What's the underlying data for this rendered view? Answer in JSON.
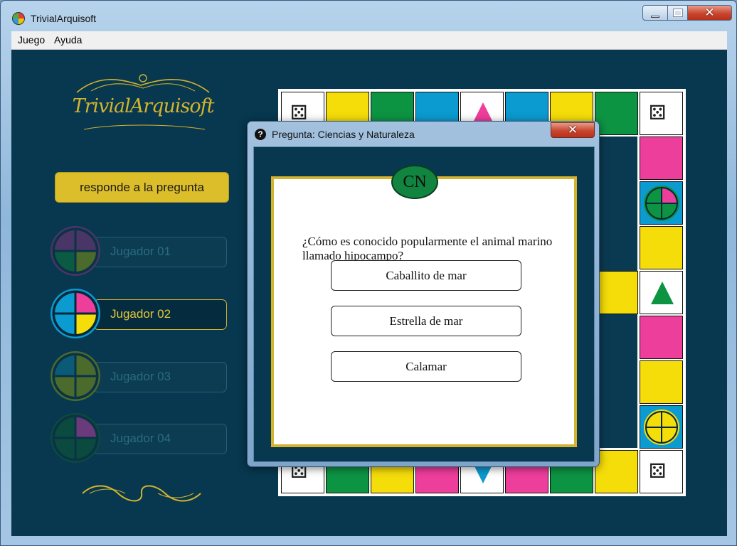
{
  "window": {
    "title": "TrivialArquisoft"
  },
  "menu": {
    "items": [
      {
        "label": "Juego"
      },
      {
        "label": "Ayuda"
      }
    ]
  },
  "left_panel": {
    "logo_text": "TrivialArquisoft",
    "respond_button": "responde a la pregunta",
    "players": [
      {
        "name": "Jugador 01",
        "active": false,
        "wedges": [
          "#4a3567",
          "#4a3567",
          "#0b5a44",
          "#4b6b2c"
        ]
      },
      {
        "name": "Jugador 02",
        "active": true,
        "wedges": [
          "#0b9bd0",
          "#ee3e9c",
          "#0b9bd0",
          "#f5dd0a"
        ]
      },
      {
        "name": "Jugador 03",
        "active": false,
        "wedges": [
          "#0b5a78",
          "#4b6b2c",
          "#4b6b2c",
          "#4b6b2c"
        ]
      },
      {
        "name": "Jugador 04",
        "active": false,
        "wedges": [
          "#0b4a3e",
          "#6a3a7a",
          "#0b4a3e",
          "#0b4a3e"
        ]
      }
    ]
  },
  "dialog": {
    "title": "Pregunta: Ciencias y Naturaleza",
    "category_badge": "CN",
    "question": "¿Cómo es conocido popularmente el animal marino llamado hipocampo?",
    "answers": [
      "Caballito de mar",
      "Estrella de mar",
      "Calamar"
    ]
  },
  "colors": {
    "background": "#07384f",
    "gold": "#d4b32e",
    "yellow": "#f5dd0a",
    "green": "#0d9443",
    "blue": "#0b9bd0",
    "pink": "#ee3e9c"
  }
}
